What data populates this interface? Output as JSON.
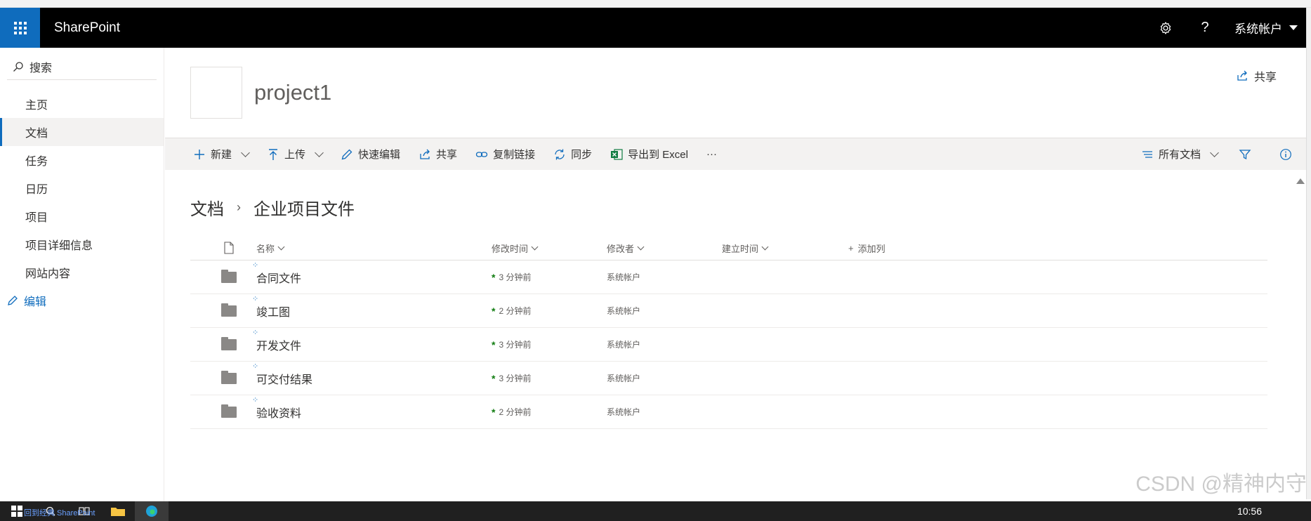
{
  "app": {
    "brand": "SharePoint"
  },
  "suite": {
    "account": "系统帐户",
    "help_label": "?"
  },
  "search": {
    "label": "搜索"
  },
  "nav": {
    "items": [
      {
        "label": "主页"
      },
      {
        "label": "文档"
      },
      {
        "label": "任务"
      },
      {
        "label": "日历"
      },
      {
        "label": "项目"
      },
      {
        "label": "项目详细信息"
      },
      {
        "label": "网站内容"
      }
    ],
    "edit_label": "编辑"
  },
  "site": {
    "title": "project1",
    "share_label": "共享"
  },
  "commands": {
    "new": "新建",
    "upload": "上传",
    "quick_edit": "快速编辑",
    "share": "共享",
    "copy_link": "复制链接",
    "sync": "同步",
    "export_excel": "导出到 Excel",
    "more": "···",
    "view": "所有文档"
  },
  "breadcrumb": {
    "root": "文档",
    "current": "企业项目文件"
  },
  "list": {
    "columns": {
      "name": "名称",
      "modified": "修改时间",
      "modified_by": "修改者",
      "created": "建立时间",
      "add": "添加列"
    },
    "rows": [
      {
        "name": "合同文件",
        "modified": "3 分钟前",
        "modified_by": "系统帐户"
      },
      {
        "name": "竣工图",
        "modified": "2 分钟前",
        "modified_by": "系统帐户"
      },
      {
        "name": "开发文件",
        "modified": "3 分钟前",
        "modified_by": "系统帐户"
      },
      {
        "name": "可交付结果",
        "modified": "3 分钟前",
        "modified_by": "系统帐户"
      },
      {
        "name": "验收资料",
        "modified": "2 分钟前",
        "modified_by": "系统帐户"
      }
    ]
  },
  "footer": {
    "status_link": "回到经典 SharePoint",
    "clock": "10:56",
    "watermark": "CSDN @精神内守"
  },
  "colors": {
    "accent": "#0f6cbd",
    "suitebar": "#000000",
    "new_marker": "#107c10"
  }
}
